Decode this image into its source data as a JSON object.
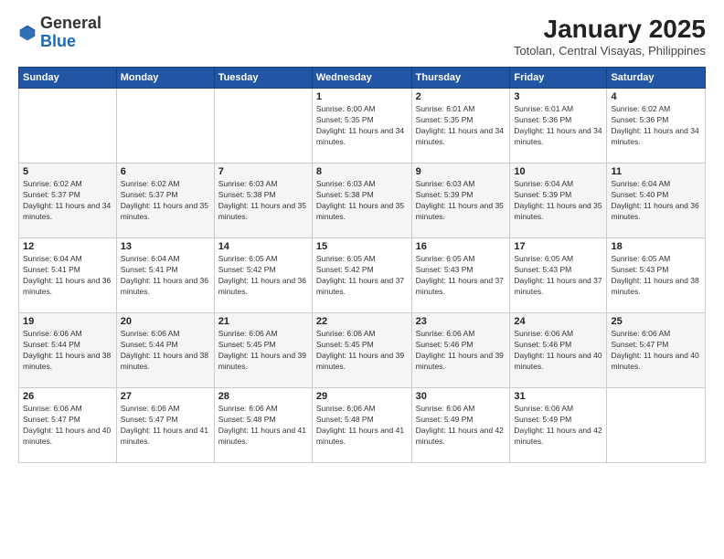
{
  "header": {
    "logo_general": "General",
    "logo_blue": "Blue",
    "month_title": "January 2025",
    "subtitle": "Totolan, Central Visayas, Philippines"
  },
  "weekdays": [
    "Sunday",
    "Monday",
    "Tuesday",
    "Wednesday",
    "Thursday",
    "Friday",
    "Saturday"
  ],
  "weeks": [
    [
      {
        "day": "",
        "sunrise": "",
        "sunset": "",
        "daylight": ""
      },
      {
        "day": "",
        "sunrise": "",
        "sunset": "",
        "daylight": ""
      },
      {
        "day": "",
        "sunrise": "",
        "sunset": "",
        "daylight": ""
      },
      {
        "day": "1",
        "sunrise": "Sunrise: 6:00 AM",
        "sunset": "Sunset: 5:35 PM",
        "daylight": "Daylight: 11 hours and 34 minutes."
      },
      {
        "day": "2",
        "sunrise": "Sunrise: 6:01 AM",
        "sunset": "Sunset: 5:35 PM",
        "daylight": "Daylight: 11 hours and 34 minutes."
      },
      {
        "day": "3",
        "sunrise": "Sunrise: 6:01 AM",
        "sunset": "Sunset: 5:36 PM",
        "daylight": "Daylight: 11 hours and 34 minutes."
      },
      {
        "day": "4",
        "sunrise": "Sunrise: 6:02 AM",
        "sunset": "Sunset: 5:36 PM",
        "daylight": "Daylight: 11 hours and 34 minutes."
      }
    ],
    [
      {
        "day": "5",
        "sunrise": "Sunrise: 6:02 AM",
        "sunset": "Sunset: 5:37 PM",
        "daylight": "Daylight: 11 hours and 34 minutes."
      },
      {
        "day": "6",
        "sunrise": "Sunrise: 6:02 AM",
        "sunset": "Sunset: 5:37 PM",
        "daylight": "Daylight: 11 hours and 35 minutes."
      },
      {
        "day": "7",
        "sunrise": "Sunrise: 6:03 AM",
        "sunset": "Sunset: 5:38 PM",
        "daylight": "Daylight: 11 hours and 35 minutes."
      },
      {
        "day": "8",
        "sunrise": "Sunrise: 6:03 AM",
        "sunset": "Sunset: 5:38 PM",
        "daylight": "Daylight: 11 hours and 35 minutes."
      },
      {
        "day": "9",
        "sunrise": "Sunrise: 6:03 AM",
        "sunset": "Sunset: 5:39 PM",
        "daylight": "Daylight: 11 hours and 35 minutes."
      },
      {
        "day": "10",
        "sunrise": "Sunrise: 6:04 AM",
        "sunset": "Sunset: 5:39 PM",
        "daylight": "Daylight: 11 hours and 35 minutes."
      },
      {
        "day": "11",
        "sunrise": "Sunrise: 6:04 AM",
        "sunset": "Sunset: 5:40 PM",
        "daylight": "Daylight: 11 hours and 36 minutes."
      }
    ],
    [
      {
        "day": "12",
        "sunrise": "Sunrise: 6:04 AM",
        "sunset": "Sunset: 5:41 PM",
        "daylight": "Daylight: 11 hours and 36 minutes."
      },
      {
        "day": "13",
        "sunrise": "Sunrise: 6:04 AM",
        "sunset": "Sunset: 5:41 PM",
        "daylight": "Daylight: 11 hours and 36 minutes."
      },
      {
        "day": "14",
        "sunrise": "Sunrise: 6:05 AM",
        "sunset": "Sunset: 5:42 PM",
        "daylight": "Daylight: 11 hours and 36 minutes."
      },
      {
        "day": "15",
        "sunrise": "Sunrise: 6:05 AM",
        "sunset": "Sunset: 5:42 PM",
        "daylight": "Daylight: 11 hours and 37 minutes."
      },
      {
        "day": "16",
        "sunrise": "Sunrise: 6:05 AM",
        "sunset": "Sunset: 5:43 PM",
        "daylight": "Daylight: 11 hours and 37 minutes."
      },
      {
        "day": "17",
        "sunrise": "Sunrise: 6:05 AM",
        "sunset": "Sunset: 5:43 PM",
        "daylight": "Daylight: 11 hours and 37 minutes."
      },
      {
        "day": "18",
        "sunrise": "Sunrise: 6:05 AM",
        "sunset": "Sunset: 5:43 PM",
        "daylight": "Daylight: 11 hours and 38 minutes."
      }
    ],
    [
      {
        "day": "19",
        "sunrise": "Sunrise: 6:06 AM",
        "sunset": "Sunset: 5:44 PM",
        "daylight": "Daylight: 11 hours and 38 minutes."
      },
      {
        "day": "20",
        "sunrise": "Sunrise: 6:06 AM",
        "sunset": "Sunset: 5:44 PM",
        "daylight": "Daylight: 11 hours and 38 minutes."
      },
      {
        "day": "21",
        "sunrise": "Sunrise: 6:06 AM",
        "sunset": "Sunset: 5:45 PM",
        "daylight": "Daylight: 11 hours and 39 minutes."
      },
      {
        "day": "22",
        "sunrise": "Sunrise: 6:06 AM",
        "sunset": "Sunset: 5:45 PM",
        "daylight": "Daylight: 11 hours and 39 minutes."
      },
      {
        "day": "23",
        "sunrise": "Sunrise: 6:06 AM",
        "sunset": "Sunset: 5:46 PM",
        "daylight": "Daylight: 11 hours and 39 minutes."
      },
      {
        "day": "24",
        "sunrise": "Sunrise: 6:06 AM",
        "sunset": "Sunset: 5:46 PM",
        "daylight": "Daylight: 11 hours and 40 minutes."
      },
      {
        "day": "25",
        "sunrise": "Sunrise: 6:06 AM",
        "sunset": "Sunset: 5:47 PM",
        "daylight": "Daylight: 11 hours and 40 minutes."
      }
    ],
    [
      {
        "day": "26",
        "sunrise": "Sunrise: 6:06 AM",
        "sunset": "Sunset: 5:47 PM",
        "daylight": "Daylight: 11 hours and 40 minutes."
      },
      {
        "day": "27",
        "sunrise": "Sunrise: 6:06 AM",
        "sunset": "Sunset: 5:47 PM",
        "daylight": "Daylight: 11 hours and 41 minutes."
      },
      {
        "day": "28",
        "sunrise": "Sunrise: 6:06 AM",
        "sunset": "Sunset: 5:48 PM",
        "daylight": "Daylight: 11 hours and 41 minutes."
      },
      {
        "day": "29",
        "sunrise": "Sunrise: 6:06 AM",
        "sunset": "Sunset: 5:48 PM",
        "daylight": "Daylight: 11 hours and 41 minutes."
      },
      {
        "day": "30",
        "sunrise": "Sunrise: 6:06 AM",
        "sunset": "Sunset: 5:49 PM",
        "daylight": "Daylight: 11 hours and 42 minutes."
      },
      {
        "day": "31",
        "sunrise": "Sunrise: 6:06 AM",
        "sunset": "Sunset: 5:49 PM",
        "daylight": "Daylight: 11 hours and 42 minutes."
      },
      {
        "day": "",
        "sunrise": "",
        "sunset": "",
        "daylight": ""
      }
    ]
  ]
}
